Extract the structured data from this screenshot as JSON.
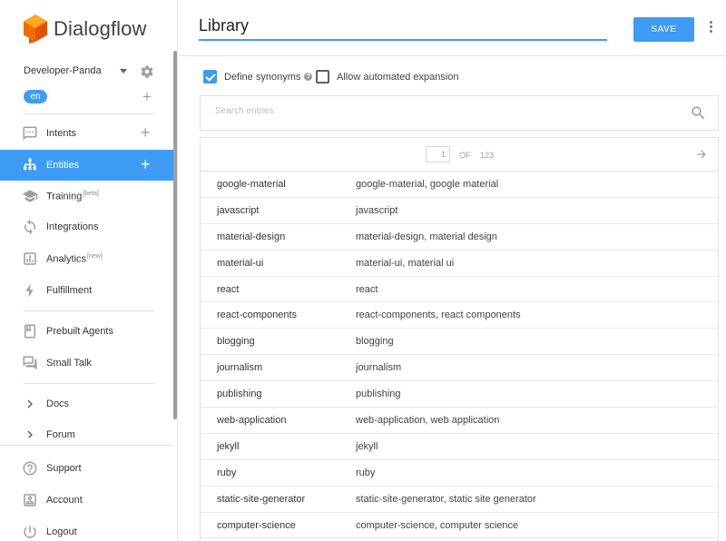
{
  "brand": {
    "name": "Dialogflow"
  },
  "agent": {
    "name": "Developer-Panda",
    "language": "en"
  },
  "nav": {
    "intents": "Intents",
    "entities": "Entities",
    "training": "Training",
    "training_badge": "[beta]",
    "integrations": "Integrations",
    "analytics": "Analytics",
    "analytics_badge": "[new]",
    "fulfillment": "Fulfillment",
    "prebuilt_agents": "Prebuilt Agents",
    "small_talk": "Small Talk",
    "docs": "Docs",
    "forum": "Forum",
    "support": "Support",
    "account": "Account",
    "logout": "Logout"
  },
  "header": {
    "title": "Library",
    "save_label": "SAVE"
  },
  "options": {
    "define_synonyms": "Define synonyms",
    "define_synonyms_checked": true,
    "allow_expansion": "Allow automated expansion",
    "allow_expansion_checked": false
  },
  "search": {
    "placeholder": "Search entries"
  },
  "pagination": {
    "current": "1",
    "of_label": "OF",
    "total": "123"
  },
  "entries": [
    {
      "value": "google-material",
      "synonyms": "google-material, google material"
    },
    {
      "value": "javascript",
      "synonyms": "javascript"
    },
    {
      "value": "material-design",
      "synonyms": "material-design, material design"
    },
    {
      "value": "material-ui",
      "synonyms": "material-ui, material ui"
    },
    {
      "value": "react",
      "synonyms": "react"
    },
    {
      "value": "react-components",
      "synonyms": "react-components, react components"
    },
    {
      "value": "blogging",
      "synonyms": "blogging"
    },
    {
      "value": "journalism",
      "synonyms": "journalism"
    },
    {
      "value": "publishing",
      "synonyms": "publishing"
    },
    {
      "value": "web-application",
      "synonyms": "web-application, web application"
    },
    {
      "value": "jekyll",
      "synonyms": "jekyll"
    },
    {
      "value": "ruby",
      "synonyms": "ruby"
    },
    {
      "value": "static-site-generator",
      "synonyms": "static-site-generator, static site generator"
    },
    {
      "value": "computer-science",
      "synonyms": "computer-science, computer science"
    }
  ],
  "colors": {
    "accent": "#3e9cf4",
    "logo": "#f57c00"
  }
}
